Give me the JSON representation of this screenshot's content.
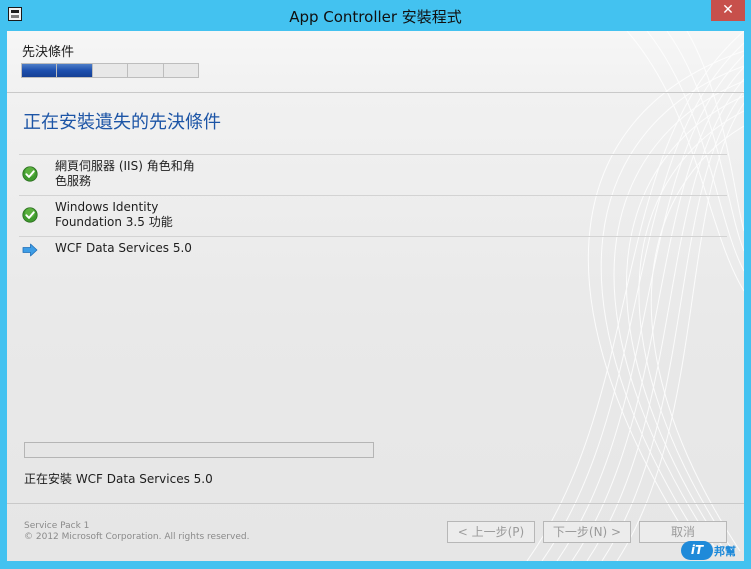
{
  "window": {
    "title": "App Controller 安裝程式",
    "close_glyph": "✕"
  },
  "wizard": {
    "step_label": "先決條件",
    "steps_total": 5,
    "steps_completed": 2,
    "accent_color": "#1d55a6"
  },
  "main": {
    "heading": "正在安裝遺失的先決條件",
    "prerequisites": [
      {
        "label": "網頁伺服器 (IIS) 角色和角\n色服務",
        "status": "installed",
        "icon": "green-check-icon"
      },
      {
        "label": "Windows Identity\nFoundation 3.5 功能",
        "status": "installed",
        "icon": "green-check-icon"
      },
      {
        "label": "WCF Data Services 5.0",
        "status": "installing",
        "icon": "blue-arrow-icon"
      }
    ],
    "progress": 0.0,
    "status_text": "正在安裝 WCF Data Services 5.0"
  },
  "footer": {
    "service_pack": "Service Pack 1",
    "copyright": "© 2012 Microsoft Corporation. All rights reserved.",
    "back_label": "< 上一步(P)",
    "next_label": "下一步(N) >",
    "cancel_label": "取消"
  },
  "watermark": {
    "it": "iT",
    "text": "邦幫忙"
  }
}
